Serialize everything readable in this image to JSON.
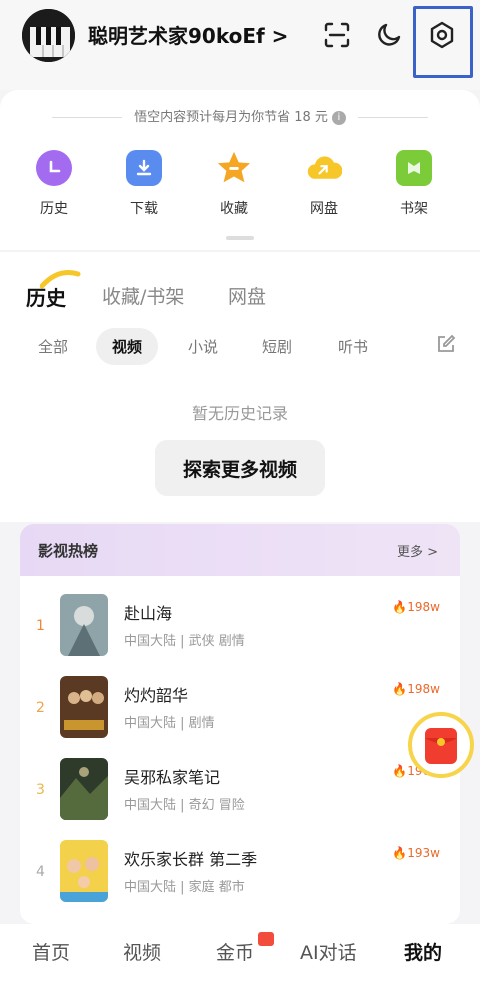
{
  "header": {
    "username": "聪明艺术家90koEf",
    "chevron": ">",
    "icons": [
      "scan-icon",
      "night-mode-icon",
      "settings-icon"
    ]
  },
  "savings": {
    "text": "悟空内容预计每月为你节省 18 元"
  },
  "quick_actions": [
    {
      "label": "历史",
      "icon": "history-icon",
      "color": "#a36bf0"
    },
    {
      "label": "下载",
      "icon": "download-icon",
      "color": "#5a8cf0"
    },
    {
      "label": "收藏",
      "icon": "star-icon",
      "color": "#f5a623"
    },
    {
      "label": "网盘",
      "icon": "cloud-icon",
      "color": "#f7c72a"
    },
    {
      "label": "书架",
      "icon": "bookshelf-icon",
      "color": "#7ccc3a"
    }
  ],
  "history": {
    "tabs": [
      "历史",
      "收藏/书架",
      "网盘"
    ],
    "subtabs": [
      "全部",
      "视频",
      "小说",
      "短剧",
      "听书"
    ],
    "active_subtab": "视频",
    "empty_text": "暂无历史记录",
    "explore_label": "探索更多视频"
  },
  "ranking": {
    "title": "影视热榜",
    "more": "更多 >",
    "items": [
      {
        "rank": "1",
        "title": "赴山海",
        "meta": "中国大陆 | 武侠 剧情",
        "heat": "198w",
        "rank_color": "#f0883a"
      },
      {
        "rank": "2",
        "title": "灼灼韶华",
        "meta": "中国大陆 | 剧情",
        "heat": "198w",
        "rank_color": "#f0a24a"
      },
      {
        "rank": "3",
        "title": "吴邪私家笔记",
        "meta": "中国大陆 | 奇幻 冒险",
        "heat": "196w",
        "rank_color": "#e8b84a"
      },
      {
        "rank": "4",
        "title": "欢乐家长群 第二季",
        "meta": "中国大陆 | 家庭 都市",
        "heat": "193w",
        "rank_color": "#aaaaaa"
      }
    ]
  },
  "bottom_nav": [
    "首页",
    "视频",
    "金币",
    "AI对话",
    "我的"
  ],
  "colors": {
    "accent": "#3a62c9",
    "heat": "#e96a2b",
    "rank_bg": "#e7d9f5"
  }
}
